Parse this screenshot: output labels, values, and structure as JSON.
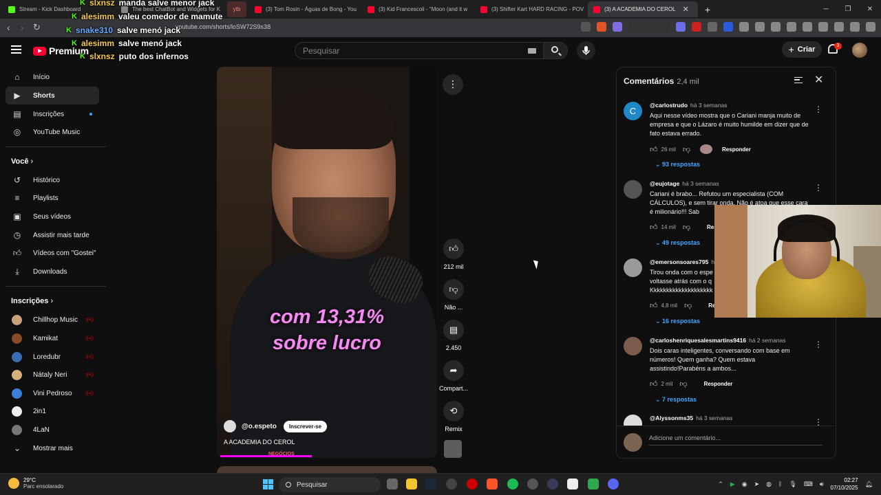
{
  "browser": {
    "tabs": [
      {
        "label": "Stream - Kick Dashboard",
        "color": "#53fc18"
      },
      {
        "label": "The best ChatBot and Widgets for Ki",
        "color": "#888888"
      },
      {
        "label": "ytb",
        "color": "#c0392b"
      },
      {
        "label": "(3) Tom Rosin - Águas de Bong - You",
        "color": "#ff0033"
      },
      {
        "label": "(3) Kid Francescoli - \"Moon (and it w",
        "color": "#ff0033"
      },
      {
        "label": "(3) Shifter Kart HARD RACING - POV",
        "color": "#ff0033"
      },
      {
        "label": "(3) A ACADEMIA DO CEROL",
        "color": "#ff0033"
      }
    ],
    "new_tab": "+",
    "url": "youtube.com/shorts/loSW72S9s38"
  },
  "chat": [
    {
      "user": "slxnsz",
      "user_color": "#f7c948",
      "message": "manda salve menor jack"
    },
    {
      "user": "alesimm",
      "user_color": "#f7c948",
      "message": "valeu comedor de mamute"
    },
    {
      "user": "snake310",
      "user_color": "#6aa8ff",
      "message": "salve menó jack"
    },
    {
      "user": "alesimm",
      "user_color": "#f7c948",
      "message": "salve menó jack"
    },
    {
      "user": "slxnsz",
      "user_color": "#f7c948",
      "message": "puto dos infernos"
    }
  ],
  "header": {
    "logo_text": "Premium",
    "search_placeholder": "Pesquisar",
    "create_label": "Criar",
    "notification_count": "3"
  },
  "sidebar": {
    "main": [
      {
        "label": "Início",
        "icon": "home-icon"
      },
      {
        "label": "Shorts",
        "icon": "shorts-icon"
      },
      {
        "label": "Inscrições",
        "icon": "subscriptions-icon"
      },
      {
        "label": "YouTube Music",
        "icon": "music-icon"
      }
    ],
    "you_title": "Você",
    "you": [
      {
        "label": "Histórico",
        "icon": "history-icon"
      },
      {
        "label": "Playlists",
        "icon": "playlists-icon"
      },
      {
        "label": "Seus vídeos",
        "icon": "your-videos-icon"
      },
      {
        "label": "Assistir mais tarde",
        "icon": "watch-later-icon"
      },
      {
        "label": "Vídeos com \"Gostei\"",
        "icon": "liked-icon"
      },
      {
        "label": "Downloads",
        "icon": "download-icon"
      }
    ],
    "subs_title": "Inscrições",
    "subs": [
      {
        "label": "Chillhop Music",
        "color": "#c9a27a"
      },
      {
        "label": "Kamikat",
        "color": "#8a4b2b"
      },
      {
        "label": "Loredubr",
        "color": "#3a6db3"
      },
      {
        "label": "Nátaly Neri",
        "color": "#d6b07a"
      },
      {
        "label": "Vini Pedroso",
        "color": "#3b7fd6"
      },
      {
        "label": "2in1",
        "color": "#eeeeee"
      },
      {
        "label": "4LaN",
        "color": "#777777"
      }
    ],
    "show_more": "Mostrar mais"
  },
  "video": {
    "caption_line1": "com 13,31%",
    "caption_line2": "sobre lucro",
    "channel": "@o.espeto",
    "subscribe_label": "Inscrever-se",
    "title": "A ACADEMIA DO CEROL",
    "watermark": "NEGÓCIOS",
    "progress": 0.43,
    "actions": {
      "likes": "212 mil",
      "dislike": "Não ...",
      "comments": "2.450",
      "share": "Compart...",
      "remix": "Remix"
    }
  },
  "comments": {
    "title": "Comentários",
    "count": "2,4 mil",
    "items": [
      {
        "user": "@carlostrudo",
        "when": "há 3 semanas",
        "text": "Aqui nesse vídeo mostra que o Cariani manja muito de empresa e que o Lázaro é muito humilde em dizer que de fato estava errado.",
        "likes": "26 mil",
        "reply": "Responder",
        "replies": "93 respostas",
        "avatar_color": "#1e88c9",
        "avatar_letter": "C"
      },
      {
        "user": "@eujotage",
        "when": "há 3 semanas",
        "text": "Cariani é brabo... Refutou um especialista (COM CÁLCULOS), e sem tirar onda. Não é atoa que esse cara é milionário!!! Sab",
        "likes": "14 mil",
        "reply": "Resp",
        "replies": "49 respostas",
        "avatar_color": "#555555",
        "avatar_letter": ""
      },
      {
        "user": "@emersonsoares795",
        "when": "há",
        "text": "Tirou onda com o espe voltasse atrás com o q Kkkkkkkkkkkkkkkkkkkk",
        "likes": "4,8 mil",
        "reply": "Resp",
        "replies": "16 respostas",
        "avatar_color": "#9a9a9a",
        "avatar_letter": ""
      },
      {
        "user": "@carloshenriquesalesmartins9416",
        "when": "há 2 semanas",
        "text": "Dois caras inteligentes, conversando com base em números! Quem ganha? Quem estava assistindo!Parabéns a ambos...",
        "likes": "2 mil",
        "reply": "Responder",
        "replies": "7 respostas",
        "avatar_color": "#7b5b4b",
        "avatar_letter": ""
      },
      {
        "user": "@Alyssonms35",
        "when": "há 3 semanas",
        "text": "",
        "likes": "",
        "reply": "",
        "replies": "",
        "avatar_color": "#dddddd",
        "avatar_letter": ""
      }
    ],
    "input_placeholder": "Adicione um comentário..."
  },
  "taskbar": {
    "temp": "29°C",
    "weather": "Parc ensolarado",
    "search": "Pesquisar",
    "time": "02:27",
    "date": "07/10/2025"
  }
}
